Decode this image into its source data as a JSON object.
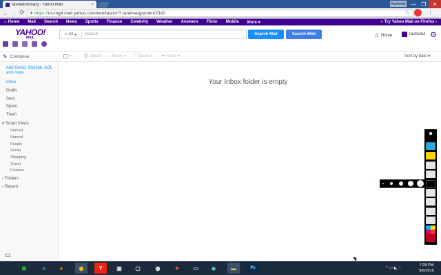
{
  "browser": {
    "tab_title": "rashedulsmarij - Yahoo Mail",
    "tab_close": "×",
    "profile": "Rashedul",
    "window_controls": {
      "minimize": "—",
      "maximize": "❐",
      "close": "✕"
    },
    "url_scheme": "https://",
    "url_rest": "us-mg4.mail.yahoo.com/neo/launch?.rand=augncobnr23o0",
    "icons": [
      "back-arrow-icon",
      "forward-arrow-icon",
      "reload-icon",
      "lock-icon",
      "star-icon",
      "extension-icon",
      "menu-icon"
    ]
  },
  "ynav": {
    "items": [
      "Home",
      "Mail",
      "Search",
      "News",
      "Sports",
      "Finance",
      "Celebrity",
      "Weather",
      "Answers",
      "Flickr",
      "Mobile",
      "More ▾"
    ],
    "try_text": "Try Yahoo Mail on Firefox ›"
  },
  "header": {
    "logo": "YAHOO!",
    "logo_sub": "MAIL",
    "search_scope": "All",
    "search_placeholder": "Search",
    "search_mail_label": "Search Mail",
    "search_web_label": "Search Web",
    "home_label": "Home",
    "user_label": "rashedul"
  },
  "actions": {
    "compose": "Compose",
    "delete": "Delete",
    "move": "Move",
    "spam": "Spam",
    "more": "More",
    "sort": "Sort by date ▾"
  },
  "sidebar": {
    "add_accounts": "Add Gmail, Outlook, AOL and more",
    "folders": [
      "Inbox",
      "Drafts",
      "Sent",
      "Spam",
      "Trash"
    ],
    "smart_views_label": "Smart Views",
    "smart_views": [
      "Unread",
      "Starred",
      "People",
      "Social",
      "Shopping",
      "Travel",
      "Finance"
    ],
    "folders_label": "Folders",
    "recent_label": "Recent"
  },
  "main": {
    "empty_message": "Your Inbox folder is empty"
  },
  "taskbar": {
    "time": "7:28 PM",
    "date": "9/6/2016",
    "apps": [
      "windows-start-icon",
      "internet-explorer-icon",
      "firefox-icon",
      "chrome-icon",
      "yandex-icon",
      "store-icon",
      "window-icon",
      "bulb-icon",
      "app-icon",
      "terminal-icon",
      "files-icon",
      "folder-icon",
      "photoshop-icon"
    ]
  },
  "colors": {
    "yahoo_purple": "#400090",
    "search_blue": "#188fff",
    "taskbar": "#1c2b3b"
  }
}
